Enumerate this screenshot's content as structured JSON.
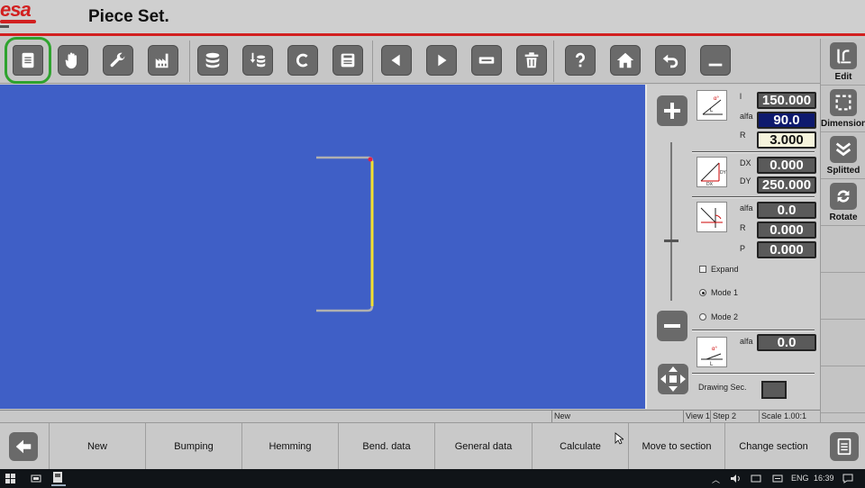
{
  "app": {
    "logo_text": "esa",
    "title": "Piece Set."
  },
  "toolbar": {
    "buttons": [
      {
        "name": "document-icon"
      },
      {
        "name": "hand-icon"
      },
      {
        "name": "wrench-icon"
      },
      {
        "name": "factory-icon"
      },
      {
        "name": "database-icon"
      },
      {
        "name": "database-download-icon"
      },
      {
        "name": "c-icon"
      },
      {
        "name": "save-icon"
      },
      {
        "name": "arrow-left-icon"
      },
      {
        "name": "arrow-right-icon"
      },
      {
        "name": "minus-box-icon"
      },
      {
        "name": "trash-icon"
      },
      {
        "name": "help-icon"
      },
      {
        "name": "home-icon"
      },
      {
        "name": "undo-icon"
      },
      {
        "name": "minimize-icon"
      }
    ]
  },
  "side_panel": {
    "items": [
      {
        "label": "Edit"
      },
      {
        "label": "Dimensioning"
      },
      {
        "label": "Splitted"
      },
      {
        "label": "Rotate"
      }
    ]
  },
  "controls": {
    "angle_group": {
      "l_label": "l",
      "l_value": "150.000",
      "alfa_label": "alfa",
      "alfa_value": "90.0",
      "r_label": "R",
      "r_value": "3.000"
    },
    "dxdy_group": {
      "dx_label": "DX",
      "dx_value": "0.000",
      "dy_label": "DY",
      "dy_value": "250.000",
      "thumb_dy": "DY",
      "thumb_dx": "DX"
    },
    "radius_group": {
      "alfa_label": "alfa",
      "alfa_value": "0.0",
      "r_label": "R",
      "r_value": "0.000",
      "p_label": "P",
      "p_value": "0.000"
    },
    "expand_label": "Expand",
    "mode1_label": "Mode 1",
    "mode2_label": "Mode 2",
    "bottom_alfa_label": "alfa",
    "bottom_alfa_value": "0.0",
    "drawing_sec_label": "Drawing Sec.",
    "thumb_alpha_text": "α°",
    "thumb_l_text": "L"
  },
  "status_bar": {
    "mode": "New",
    "view": "View 1",
    "step": "Step 2",
    "scale": "Scale 1.00:1"
  },
  "commands": [
    {
      "label": "New"
    },
    {
      "label": "Bumping"
    },
    {
      "label": "Hemming"
    },
    {
      "label": "Bend. data"
    },
    {
      "label": "General data"
    },
    {
      "label": "Calculate"
    },
    {
      "label": "Move to section"
    },
    {
      "label": "Change section"
    }
  ],
  "taskbar": {
    "language": "ENG",
    "time": "16:39"
  },
  "colors": {
    "accent_red": "#d22020",
    "canvas_blue": "#3f5fc6",
    "profile_gray": "#b0b0b0",
    "active_segment": "#f2e030",
    "selection_green": "#2fa32f"
  }
}
